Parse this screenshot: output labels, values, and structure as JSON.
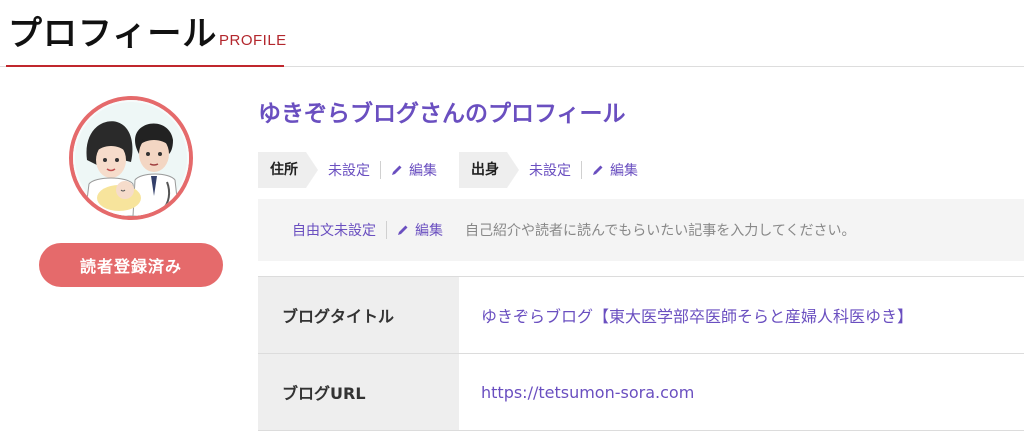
{
  "header": {
    "title": "プロフィール",
    "subtitle": "PROFILE"
  },
  "profile": {
    "name": "ゆきぞらブログさんのプロフィール",
    "subscribe_label": "読者登録済み",
    "address": {
      "label": "住所",
      "value": "未設定",
      "edit_label": "編集"
    },
    "hometown": {
      "label": "出身",
      "value": "未設定",
      "edit_label": "編集"
    },
    "free_text": {
      "value": "自由文未設定",
      "edit_label": "編集",
      "placeholder": "自己紹介や読者に読んでもらいたい記事を入力してください。"
    }
  },
  "details": [
    {
      "label": "ブログタイトル",
      "value": "ゆきぞらブログ【東大医学部卒医師そらと産婦人科医ゆき】"
    },
    {
      "label": "ブログURL",
      "value": "https://tetsumon-sora.com"
    }
  ],
  "colors": {
    "accent": "#c0272d",
    "link": "#6a4fc0",
    "button": "#e56a6b"
  },
  "icons": {
    "edit": "pencil-icon"
  }
}
